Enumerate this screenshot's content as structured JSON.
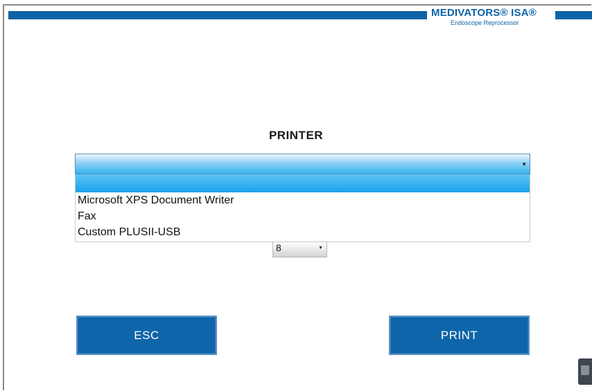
{
  "brand": {
    "name": "MEDIVATORS® ISA®",
    "subtitle": "Endoscope Reprocessor"
  },
  "page": {
    "title": "PRINTER"
  },
  "printer_select": {
    "selected_value": "",
    "options": [
      "",
      "Microsoft XPS Document Writer",
      "Fax",
      "Custom PLUSII-USB"
    ]
  },
  "copies_select": {
    "value": "8"
  },
  "buttons": {
    "esc_label": "ESC",
    "print_label": "PRINT"
  },
  "colors": {
    "brand_blue": "#0d63a5",
    "button_blue": "#0e65a9",
    "highlight_blue": "#1aa3ec"
  }
}
